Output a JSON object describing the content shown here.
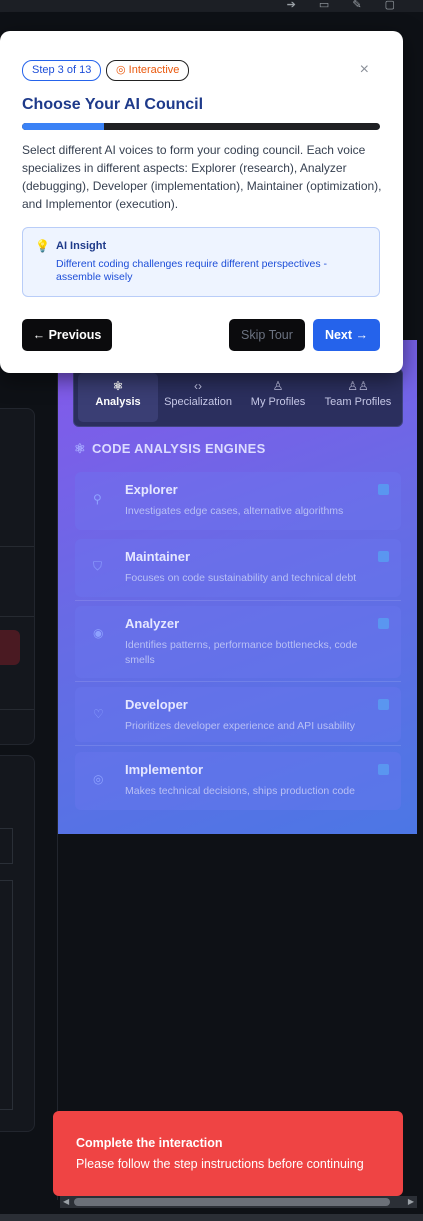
{
  "modal": {
    "step_badge": "Step 3 of 13",
    "interactive_badge": "Interactive",
    "close_symbol": "×",
    "title": "Choose Your AI Council",
    "progress_fraction": 0.23,
    "body": "Select different AI voices to form your coding council. Each voice specializes in different aspects: Explorer (research), Analyzer (debugging), Developer (implementation), Maintainer (optimization), and Implementor (execution).",
    "insight_title": "AI Insight",
    "insight_text": "Different coding challenges require different perspectives - assemble wisely",
    "previous_label": "Previous",
    "skip_label": "Skip Tour",
    "next_label": "Next"
  },
  "tabs": [
    {
      "label": "Analysis",
      "icon": "brain-icon",
      "active": true
    },
    {
      "label": "Specialization",
      "icon": "code-icon",
      "active": false
    },
    {
      "label": "My Profiles",
      "icon": "user-icon",
      "active": false
    },
    {
      "label": "Team Profiles",
      "icon": "users-icon",
      "active": false
    }
  ],
  "section_title": "CODE ANALYSIS ENGINES",
  "engines": [
    {
      "name": "Explorer",
      "desc": "Investigates edge cases, alternative algorithms",
      "icon": "search-icon"
    },
    {
      "name": "Maintainer",
      "desc": "Focuses on code sustainability and technical debt",
      "icon": "shield-icon"
    },
    {
      "name": "Analyzer",
      "desc": "Identifies patterns, performance bottlenecks, code smells",
      "icon": "eye-icon"
    },
    {
      "name": "Developer",
      "desc": "Prioritizes developer experience and API usability",
      "icon": "heart-icon"
    },
    {
      "name": "Implementor",
      "desc": "Makes technical decisions, ships production code",
      "icon": "target-icon"
    }
  ],
  "toast": {
    "title": "Complete the interaction",
    "message": "Please follow the step instructions before continuing"
  },
  "colors": {
    "accent": "#2563eb",
    "toast": "#ef4444",
    "interactive": "#ea580c"
  }
}
